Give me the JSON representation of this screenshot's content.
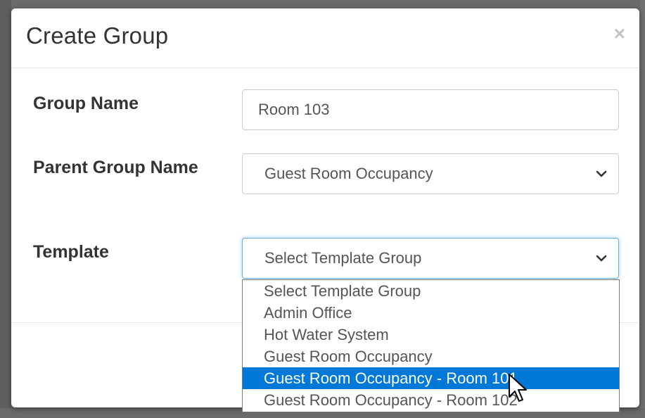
{
  "dialog": {
    "title": "Create Group",
    "close_label": "×"
  },
  "form": {
    "group_name": {
      "label": "Group Name",
      "value": "Room 103"
    },
    "parent_group": {
      "label": "Parent Group Name",
      "selected": "Guest Room Occupancy"
    },
    "template": {
      "label": "Template",
      "selected": "Select Template Group"
    }
  },
  "template_dropdown": {
    "options": [
      "Select Template Group",
      "Admin Office",
      "Hot Water System",
      "Guest Room Occupancy",
      "Guest Room Occupancy - Room 101",
      "Guest Room Occupancy - Room 102"
    ],
    "highlighted_option": "Guest Room Occupancy - Room 101"
  },
  "icons": {
    "close": "close-icon",
    "dropdown_chevron": "chevron-down-icon",
    "cursor": "mouse-pointer-icon"
  },
  "colors": {
    "highlight": "#0078d7",
    "focus_border": "#66afe9",
    "overlay": "#6f6f6f"
  }
}
